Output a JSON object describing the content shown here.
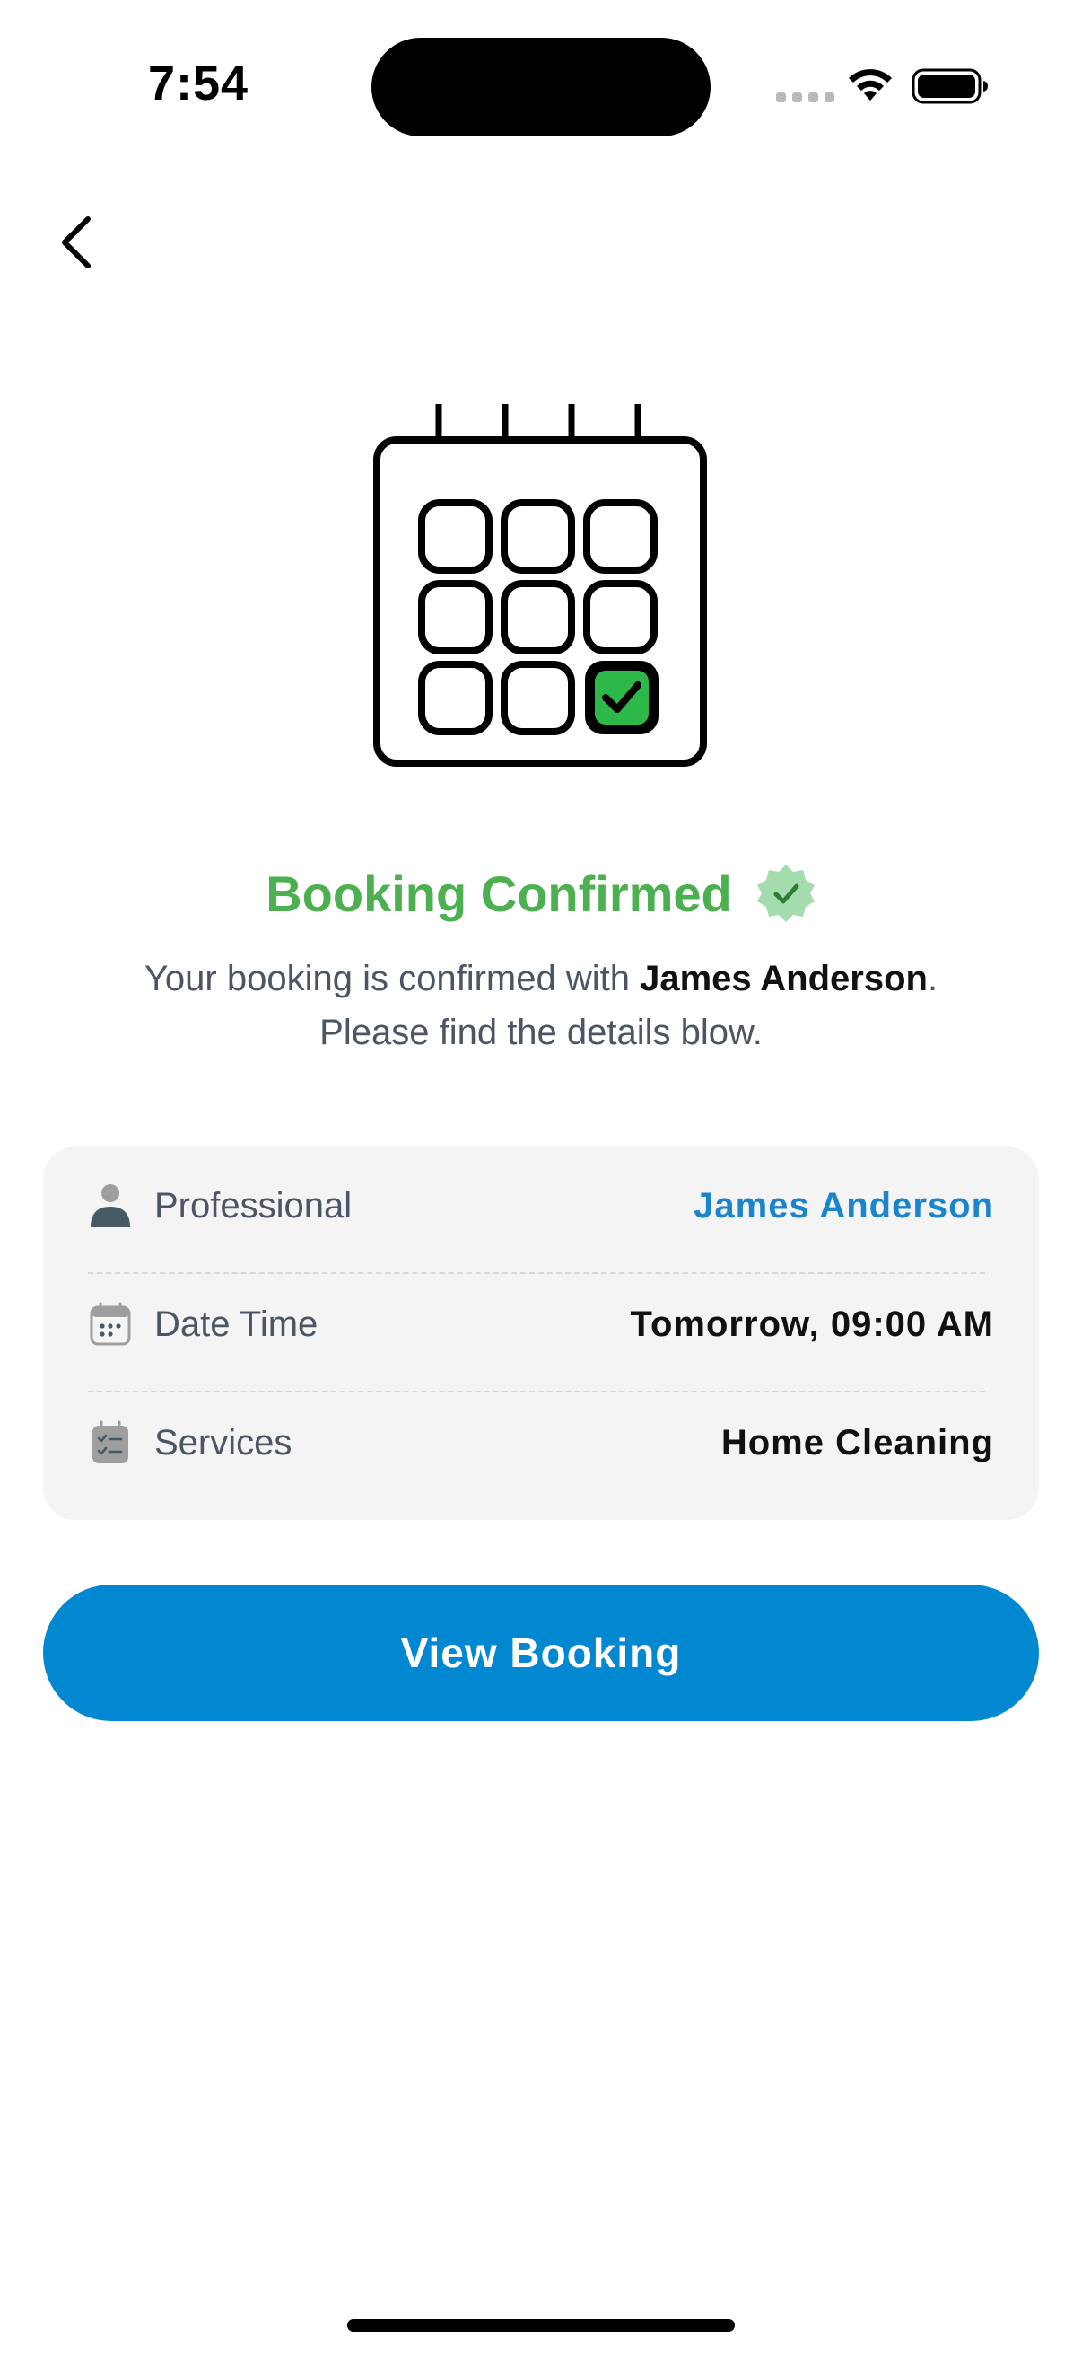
{
  "status_bar": {
    "time": "7:54"
  },
  "header": {
    "back_icon": "chevron-left-icon"
  },
  "hero": {
    "icon": "calendar-check-icon"
  },
  "confirmation": {
    "title": "Booking Confirmed",
    "title_color": "#4caf50",
    "badge_icon": "verified-badge-icon",
    "subtitle_prefix": "Your booking is confirmed with ",
    "subtitle_name": "James Anderson",
    "subtitle_suffix": ".",
    "subtitle_line2": "Please find the details blow."
  },
  "details": [
    {
      "icon": "person-icon",
      "label": "Professional",
      "value": "James Anderson",
      "value_color": "#1a84cc"
    },
    {
      "icon": "calendar-icon",
      "label": "Date Time",
      "value": "Tomorrow, 09:00 AM"
    },
    {
      "icon": "checklist-icon",
      "label": "Services",
      "value": "Home Cleaning"
    }
  ],
  "actions": {
    "view_booking_label": "View Booking",
    "button_color": "#0288d1"
  }
}
